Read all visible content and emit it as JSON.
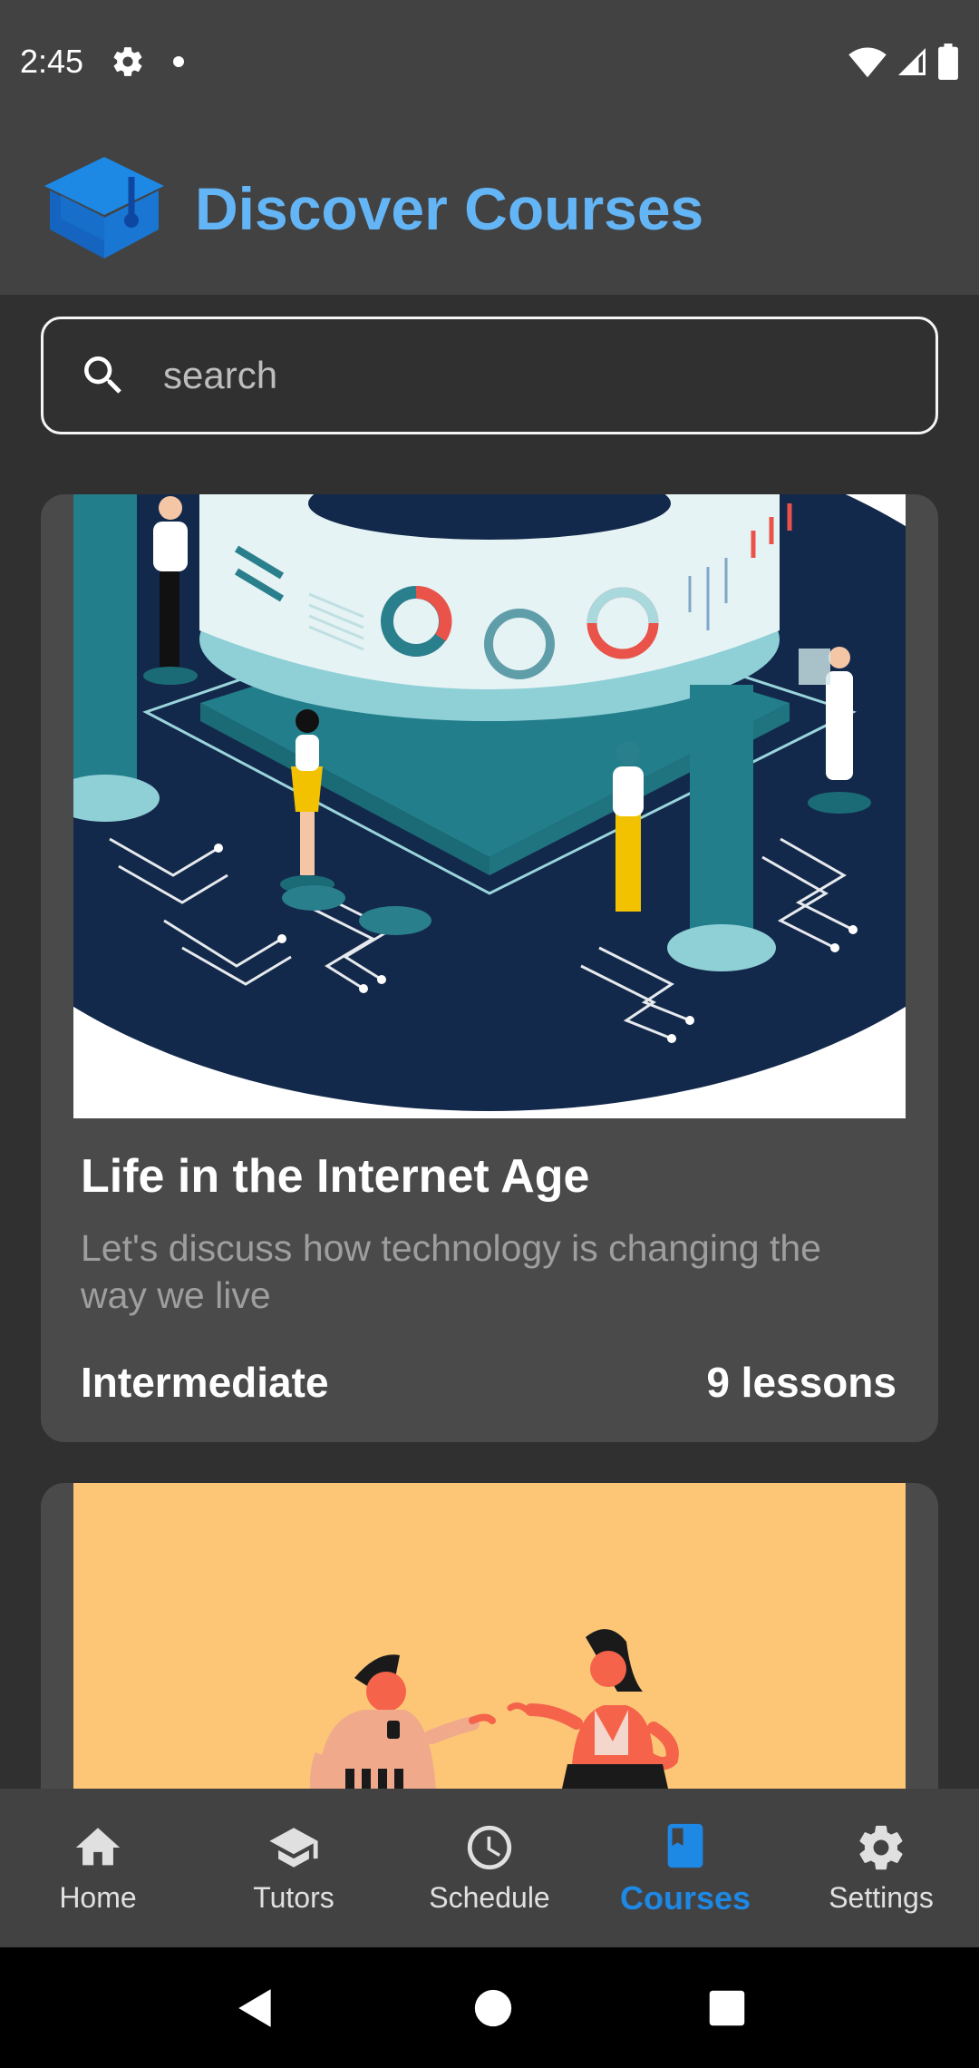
{
  "status_bar": {
    "time": "2:45"
  },
  "header": {
    "title": "Discover Courses",
    "logo_icon": "graduation-cap-icon",
    "logo_color": "#1e88e5",
    "title_color": "#64b5f6"
  },
  "search": {
    "placeholder": "search",
    "value": ""
  },
  "courses": [
    {
      "title": "Life in the Internet Age",
      "description": "Let's discuss how technology is changing the way we live",
      "level": "Intermediate",
      "lessons": "9 lessons",
      "image_theme": "isometric-tech-illustration"
    },
    {
      "image_theme": "conversation-illustration",
      "image_bg": "#fdc677"
    }
  ],
  "bottom_nav": {
    "items": [
      {
        "label": "Home",
        "icon": "home-icon"
      },
      {
        "label": "Tutors",
        "icon": "school-icon"
      },
      {
        "label": "Schedule",
        "icon": "clock-icon"
      },
      {
        "label": "Courses",
        "icon": "book-icon"
      },
      {
        "label": "Settings",
        "icon": "gear-icon"
      }
    ],
    "active": "Courses",
    "active_color": "#1e88e5"
  }
}
